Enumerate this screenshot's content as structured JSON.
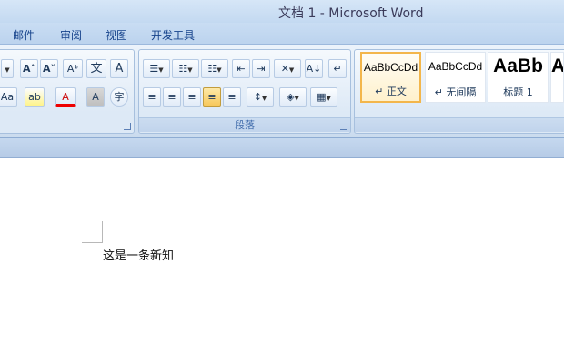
{
  "window": {
    "title": "文档 1 - Microsoft Word"
  },
  "tabs": [
    "邮件",
    "审阅",
    "视图",
    "开发工具"
  ],
  "font_group": {
    "grow_font": "A˄",
    "shrink_font": "A˅",
    "clear_format": "Aᵇ",
    "phonetic": "文",
    "border_char": "A",
    "change_case": "Aa",
    "highlight": "ab",
    "font_color": "A",
    "shading_char": "A",
    "enclose_char": "字"
  },
  "paragraph_group": {
    "label": "段落",
    "bullets": "☰",
    "numbering": "☷",
    "multilevel": "☷",
    "decrease_indent": "⇤",
    "increase_indent": "⇥",
    "chinese_layout": "✕",
    "sort": "A↓",
    "show_marks": "↵",
    "align_left": "≡",
    "center": "≡",
    "align_right": "≡",
    "justify": "≡",
    "distributed": "≡",
    "line_spacing": "↕",
    "shading": "◈",
    "borders": "▦"
  },
  "styles_gallery": [
    {
      "sample": "AaBbCcDd",
      "name": "↵ 正文",
      "selected": true
    },
    {
      "sample": "AaBbCcDd",
      "name": "↵ 无间隔",
      "selected": false
    },
    {
      "sample": "AaBb",
      "name": "标题 1",
      "selected": false,
      "big": true
    },
    {
      "sample": "A",
      "name": "",
      "selected": false,
      "big": true
    }
  ],
  "document": {
    "text": "这是一条新知"
  }
}
